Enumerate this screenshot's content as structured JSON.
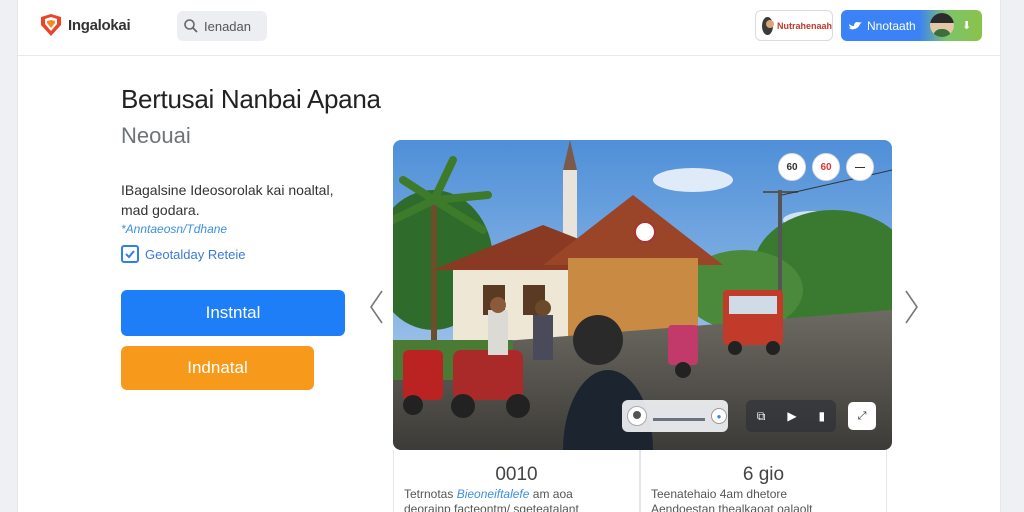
{
  "header": {
    "brand": "Ingalokai",
    "search_text": "Ienadan",
    "chip_red_text": "Nutrahenaah",
    "chip_blue_text": "Nnotaath",
    "icons": [
      "brand-logo-icon",
      "search-icon",
      "bird-icon",
      "chevron-down-icon"
    ]
  },
  "main": {
    "title": "Bertusai Nanbai Apana",
    "subtitle": "Neouai",
    "description": "IBagalsine Ideosorolak kai noaltal, mad godara.",
    "link": "*Anntaeosn/Tdhane",
    "checkbox": {
      "label": "Geotalday Reteie",
      "checked": true
    },
    "primary_button": "Instntal",
    "secondary_button": "Indnatal"
  },
  "carousel": {
    "top_buttons": [
      "60",
      "60",
      "—"
    ],
    "controls": [
      "⧉",
      "▶",
      "▮"
    ],
    "fullscreen": "⤢",
    "pill_badge": "●"
  },
  "stats": [
    {
      "value": "0010",
      "label_prefix": "Tetrnotas",
      "label_highlight": "Bieoneiftalefe",
      "label_suffix": "am aoa",
      "label_line2": "deorainp facteontm/ sgeteatalant"
    },
    {
      "value": "6 gio",
      "label_prefix": "Teenatehaio 4am dhetore",
      "label_highlight": "",
      "label_suffix": "",
      "label_line2": "Aendoestan thealkaoat oalaolt"
    }
  ],
  "colors": {
    "primary": "#1e7ef7",
    "secondary": "#f79a1c",
    "accent_link": "#3d8fe0"
  }
}
